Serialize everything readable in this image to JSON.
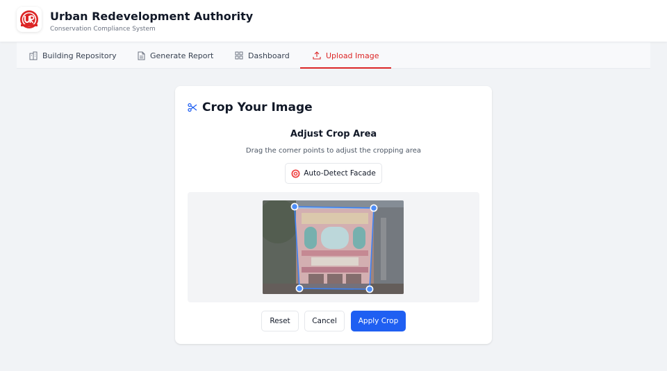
{
  "header": {
    "title": "Urban Redevelopment Authority",
    "subtitle": "Conservation Compliance System",
    "logo_text": "UR",
    "brand_color": "#dc2626"
  },
  "nav": {
    "tabs": [
      {
        "label": "Building Repository",
        "icon": "building-icon",
        "active": false
      },
      {
        "label": "Generate Report",
        "icon": "document-icon",
        "active": false
      },
      {
        "label": "Dashboard",
        "icon": "dashboard-grid-icon",
        "active": false
      },
      {
        "label": "Upload Image",
        "icon": "upload-icon",
        "active": true
      }
    ],
    "active_color": "#dc2626"
  },
  "card": {
    "title": "Crop Your Image",
    "title_icon": "scissors-icon",
    "section_title": "Adjust Crop Area",
    "section_desc": "Drag the corner points to adjust the cropping area",
    "auto_detect_label": "Auto-Detect Facade",
    "auto_detect_icon": "target-icon",
    "image_alt": "Shophouse facade photo",
    "handle_color": "#3b82f6"
  },
  "actions": {
    "reset_label": "Reset",
    "cancel_label": "Cancel",
    "apply_label": "Apply Crop",
    "apply_color": "#1f5ff2"
  }
}
